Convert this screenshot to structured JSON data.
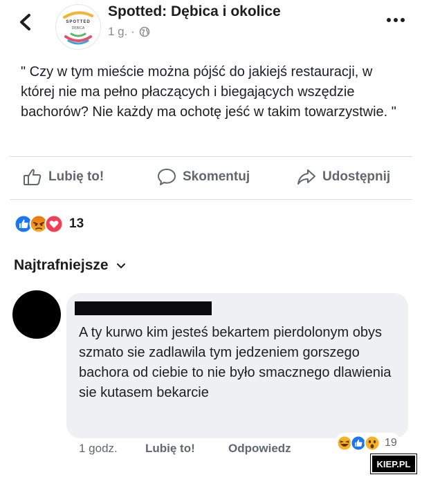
{
  "header": {
    "page_name": "Spotted: Dębica i okolice",
    "time": "1 g. ·",
    "logo": {
      "title": "SPOTTED",
      "subtitle": "DĘBICA"
    }
  },
  "post": {
    "text": "\" Czy w tym mieście można pójść do jakiejś restauracji, w której nie ma pełno płaczących i biegających wszędzie bachorów? Nie każdy ma ochotę jeść w takim towarzystwie. \""
  },
  "actions": {
    "like": "Lubię to!",
    "comment": "Skomentuj",
    "share": "Udostępnij"
  },
  "reactions": {
    "count": "13",
    "types": [
      "like-icon",
      "angry-icon",
      "love-icon"
    ]
  },
  "comments_filter": {
    "label": "Najtrafniejsze"
  },
  "comment": {
    "text": "A ty kurwo kim jesteś bekartem pierdolonym obys szmato sie zadlawila tym jedzeniem gorszego bachora od ciebie to nie było smacznego dlawienia sie kutasem bekarcie",
    "time": "1 godz.",
    "like": "Lubię to!",
    "reply": "Odpowiedz",
    "reaction_count": "19",
    "reaction_types": [
      "haha-icon",
      "like-icon",
      "wow-icon"
    ]
  },
  "watermark": {
    "text": "KIEP.PL"
  },
  "colors": {
    "like_blue": "#1877f2",
    "love_red": "#f33e58",
    "angry_orange": "#e9710f",
    "reaction_yellow": "#f7b125",
    "bubble_gray": "#eef0f4",
    "meta_gray": "#8a8d91"
  }
}
